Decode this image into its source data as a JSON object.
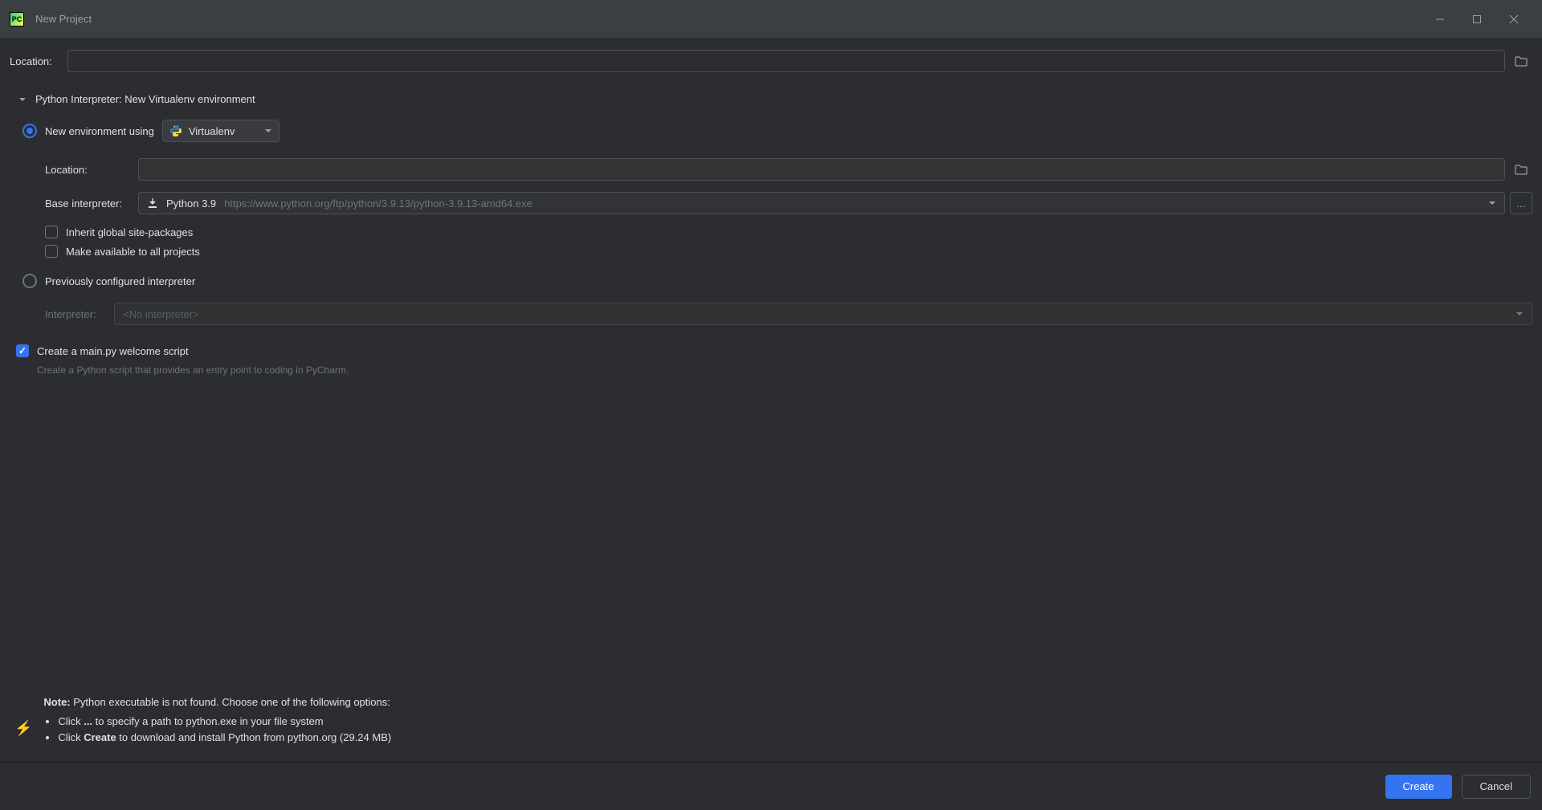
{
  "window": {
    "title": "New Project"
  },
  "location": {
    "label": "Location:",
    "value": ""
  },
  "interpreter_section": {
    "header": "Python Interpreter: New Virtualenv environment"
  },
  "new_env": {
    "radio_label": "New environment using",
    "combo_value": "Virtualenv",
    "location_label": "Location:",
    "location_value": "",
    "base_label": "Base interpreter:",
    "base_name": "Python 3.9",
    "base_url": "https://www.python.org/ftp/python/3.9.13/python-3.9.13-amd64.exe",
    "inherit_label": "Inherit global site-packages",
    "make_available_label": "Make available to all projects"
  },
  "prev_env": {
    "radio_label": "Previously configured interpreter",
    "interpreter_label": "Interpreter:",
    "interpreter_value": "<No interpreter>"
  },
  "welcome": {
    "label": "Create a main.py welcome script",
    "hint": "Create a Python script that provides an entry point to coding in PyCharm."
  },
  "note": {
    "prefix": "Note:",
    "text": " Python executable is not found. Choose one of the following options:",
    "bullet1_pre": "Click ",
    "bullet1_bold": "...",
    "bullet1_post": " to specify a path to python.exe in your file system",
    "bullet2_pre": "Click ",
    "bullet2_bold": "Create",
    "bullet2_post": " to download and install Python from python.org (29.24 MB)"
  },
  "buttons": {
    "create": "Create",
    "cancel": "Cancel"
  }
}
